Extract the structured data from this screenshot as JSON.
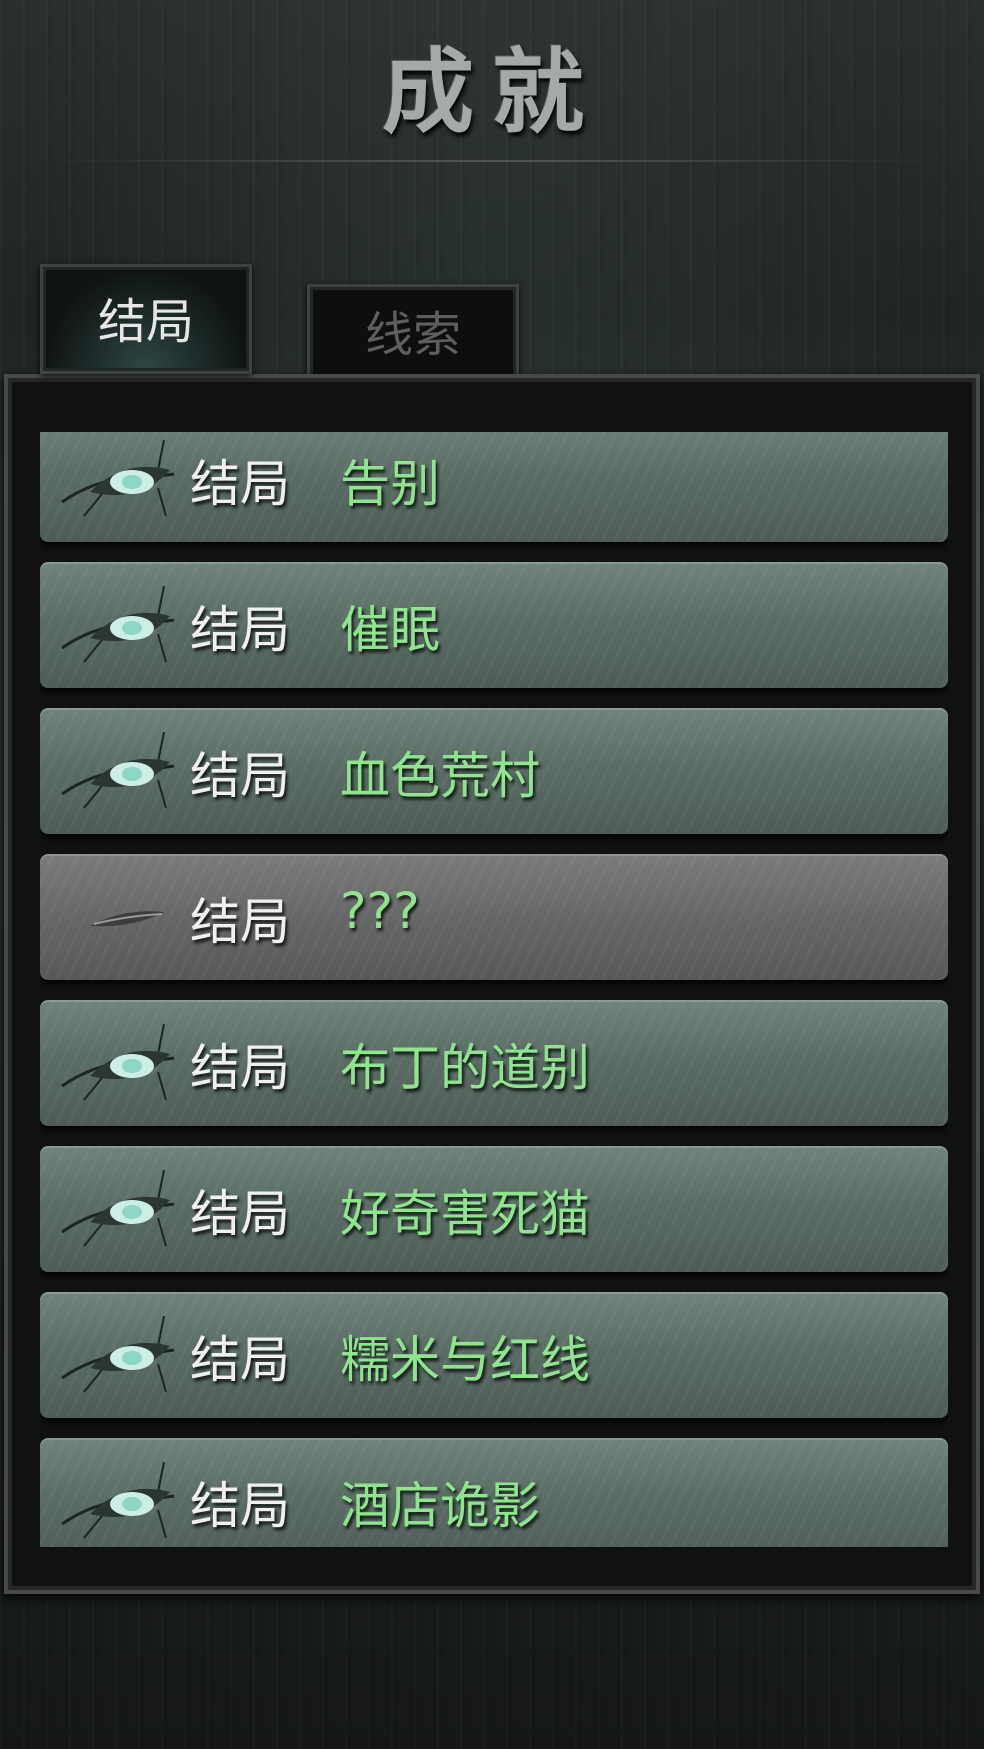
{
  "title": "成就",
  "tabs": [
    {
      "label": "结局",
      "active": true
    },
    {
      "label": "线索",
      "active": false
    }
  ],
  "endings": [
    {
      "prefix": "结局",
      "name": "告别",
      "unlocked": true
    },
    {
      "prefix": "结局",
      "name": "催眠",
      "unlocked": true
    },
    {
      "prefix": "结局",
      "name": "血色荒村",
      "unlocked": true
    },
    {
      "prefix": "结局",
      "name": "???",
      "unlocked": false
    },
    {
      "prefix": "结局",
      "name": "布丁的道别",
      "unlocked": true
    },
    {
      "prefix": "结局",
      "name": "好奇害死猫",
      "unlocked": true
    },
    {
      "prefix": "结局",
      "name": "糯米与红线",
      "unlocked": true
    },
    {
      "prefix": "结局",
      "name": "酒店诡影",
      "unlocked": true
    }
  ],
  "colors": {
    "ending_name": "#8ee58e",
    "prefix": "#f0f0f0"
  },
  "icons": {
    "unlocked": "open-eye-icon",
    "locked": "closed-eye-icon"
  }
}
